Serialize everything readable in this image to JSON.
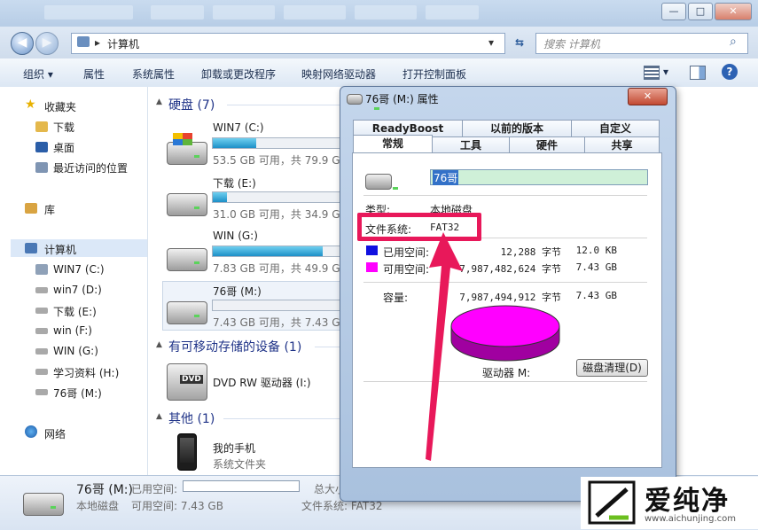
{
  "window": {
    "blur_tabs": [
      "",
      "",
      "",
      "",
      "",
      ""
    ],
    "minimize": "—",
    "maximize": "□",
    "close": "✕"
  },
  "address": {
    "path": "计算机",
    "back": "◀",
    "forward": "▶",
    "search_placeholder": "搜索 计算机"
  },
  "toolbar": {
    "organize": "组织 ▾",
    "properties": "属性",
    "system_properties": "系统属性",
    "uninstall": "卸载或更改程序",
    "map_drive": "映射网络驱动器",
    "control_panel": "打开控制面板"
  },
  "nav": {
    "favorites": "收藏夹",
    "downloads": "下载",
    "desktop": "桌面",
    "recent": "最近访问的位置",
    "libraries": "库",
    "computer": "计算机",
    "drives": [
      "WIN7 (C:)",
      "win7 (D:)",
      "下载 (E:)",
      "win (F:)",
      "WIN (G:)",
      "学习资料 (H:)",
      "76哥 (M:)"
    ],
    "network": "网络"
  },
  "content": {
    "hdd_group": "硬盘 (7)",
    "drives": [
      {
        "name": "WIN7 (C:)",
        "info": "53.5 GB 可用，共 79.9 GB",
        "used_fraction": 0.33
      },
      {
        "name": "下载 (E:)",
        "info": "31.0 GB 可用，共 34.9 GB",
        "used_fraction": 0.11
      },
      {
        "name": "WIN (G:)",
        "info": "7.83 GB 可用，共 49.9 GB",
        "used_fraction": 0.84
      },
      {
        "name": "76哥 (M:)",
        "info": "7.43 GB 可用，共 7.43 GB",
        "used_fraction": 0.0
      }
    ],
    "removable_group": "有可移动存储的设备 (1)",
    "dvd_name": "DVD RW 驱动器 (I:)",
    "dvd_label": "DVD",
    "other_group": "其他 (1)",
    "phone_name": "我的手机",
    "phone_sub": "系统文件夹"
  },
  "status": {
    "name": "76哥 (M:)",
    "type": "本地磁盘",
    "used_label": "已用空间:",
    "free": "可用空间: 7.43 GB",
    "total_label": "总大小",
    "fs_label": "文件系统: FAT32"
  },
  "dialog": {
    "title": "76哥 (M:) 属性",
    "close": "✕",
    "tabs_top": [
      "ReadyBoost",
      "以前的版本",
      "自定义"
    ],
    "tabs_bottom": [
      "常规",
      "工具",
      "硬件",
      "共享"
    ],
    "volume_label": "76哥",
    "type_label": "类型:",
    "type_value": "本地磁盘",
    "fs_label": "文件系统:",
    "fs_value": "FAT32",
    "used_label": "已用空间:",
    "used_bytes": "12,288 字节",
    "used_size": "12.0 KB",
    "free_label": "可用空间:",
    "free_bytes": "7,987,482,624 字节",
    "free_size": "7.43 GB",
    "capacity_label": "容量:",
    "capacity_bytes": "7,987,494,912 字节",
    "capacity_size": "7.43 GB",
    "drive_label": "驱动器 M:",
    "cleanup": "磁盘清理(D)",
    "used_color": "#1010e0",
    "free_color": "#ff00ff"
  },
  "watermark": {
    "brand": "爱纯净",
    "url": "www.aichunjing.com"
  }
}
